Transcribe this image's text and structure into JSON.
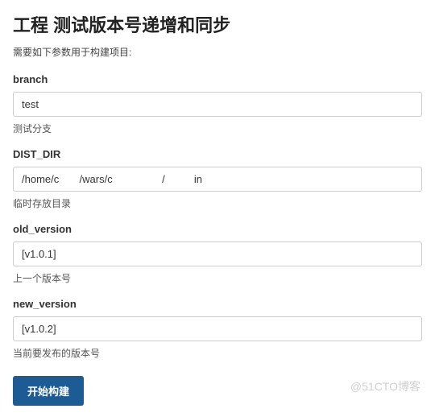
{
  "header": {
    "title": "工程 测试版本号递增和同步",
    "description": "需要如下参数用于构建项目:"
  },
  "params": {
    "branch": {
      "label": "branch",
      "value": "test",
      "help": "测试分支"
    },
    "dist_dir": {
      "label": "DIST_DIR",
      "value": "/home/c       /wars/c                 /          in",
      "help": "临时存放目录"
    },
    "old_version": {
      "label": "old_version",
      "value": "[v1.0.1]",
      "help": "上一个版本号"
    },
    "new_version": {
      "label": "new_version",
      "value": "[v1.0.2]",
      "help": "当前要发布的版本号"
    }
  },
  "actions": {
    "build_label": "开始构建"
  },
  "watermark": "@51CTO博客"
}
